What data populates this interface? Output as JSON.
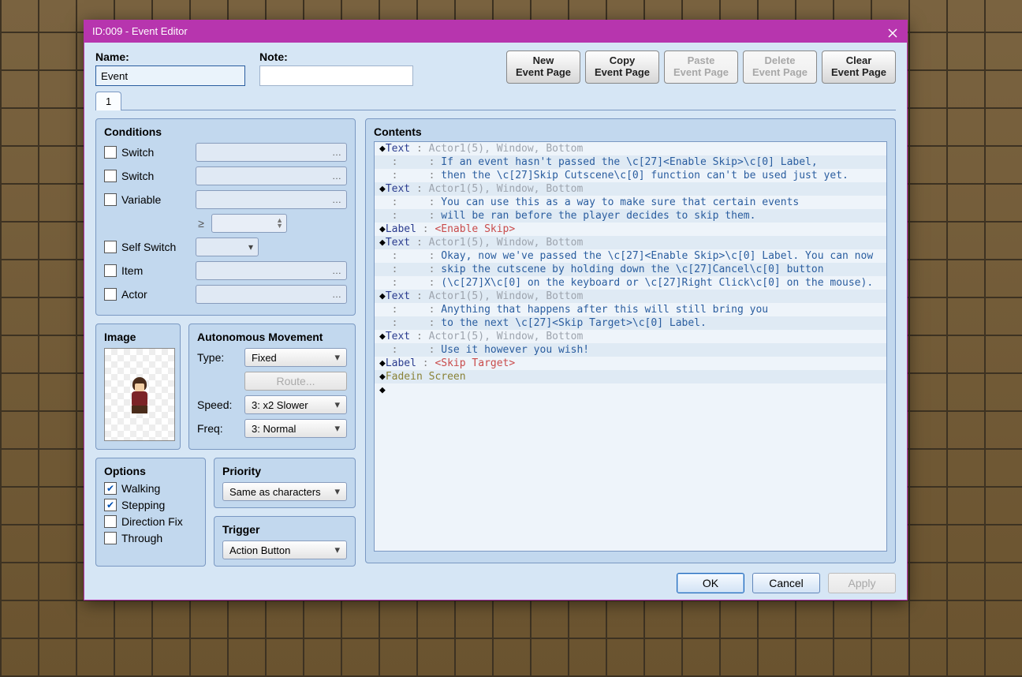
{
  "title": "ID:009 - Event Editor",
  "name_label": "Name:",
  "note_label": "Note:",
  "name_value": "Event",
  "note_value": "",
  "page_buttons": [
    {
      "l1": "New",
      "l2": "Event Page",
      "disabled": false
    },
    {
      "l1": "Copy",
      "l2": "Event Page",
      "disabled": false
    },
    {
      "l1": "Paste",
      "l2": "Event Page",
      "disabled": true
    },
    {
      "l1": "Delete",
      "l2": "Event Page",
      "disabled": true
    },
    {
      "l1": "Clear",
      "l2": "Event Page",
      "disabled": false
    }
  ],
  "tabs": [
    "1"
  ],
  "conditions": {
    "heading": "Conditions",
    "rows": [
      {
        "label": "Switch",
        "kind": "dd"
      },
      {
        "label": "Switch",
        "kind": "dd"
      },
      {
        "label": "Variable",
        "kind": "dd"
      },
      {
        "label": "",
        "kind": "ge_spin",
        "ge": "≥"
      },
      {
        "label": "Self Switch",
        "kind": "dd_s"
      },
      {
        "label": "Item",
        "kind": "dd"
      },
      {
        "label": "Actor",
        "kind": "dd"
      }
    ]
  },
  "image_heading": "Image",
  "auto": {
    "heading": "Autonomous Movement",
    "type_label": "Type:",
    "type_value": "Fixed",
    "route_label": "Route...",
    "speed_label": "Speed:",
    "speed_value": "3: x2 Slower",
    "freq_label": "Freq:",
    "freq_value": "3: Normal"
  },
  "options": {
    "heading": "Options",
    "items": [
      {
        "label": "Walking",
        "checked": true
      },
      {
        "label": "Stepping",
        "checked": true
      },
      {
        "label": "Direction Fix",
        "checked": false
      },
      {
        "label": "Through",
        "checked": false
      }
    ]
  },
  "priority": {
    "heading": "Priority",
    "value": "Same as characters"
  },
  "trigger": {
    "heading": "Trigger",
    "value": "Action Button"
  },
  "contents_heading": "Contents",
  "contents": [
    {
      "t": "text-head",
      "meta": "Actor1(5), Window, Bottom"
    },
    {
      "t": "text-line",
      "body": "If an event hasn't passed the \\c[27]<Enable Skip>\\c[0] Label,"
    },
    {
      "t": "text-line",
      "body": "then the \\c[27]Skip Cutscene\\c[0] function can't be used just yet."
    },
    {
      "t": "text-head",
      "meta": "Actor1(5), Window, Bottom"
    },
    {
      "t": "text-line",
      "body": "You can use this as a way to make sure that certain events"
    },
    {
      "t": "text-line",
      "body": "will be ran before the player decides to skip them."
    },
    {
      "t": "label",
      "body": "<Enable Skip>"
    },
    {
      "t": "text-head",
      "meta": "Actor1(5), Window, Bottom"
    },
    {
      "t": "text-line",
      "body": "Okay, now we've passed the \\c[27]<Enable Skip>\\c[0] Label. You can now"
    },
    {
      "t": "text-line",
      "body": "skip the cutscene by holding down the \\c[27]Cancel\\c[0] button"
    },
    {
      "t": "text-line",
      "body": "(\\c[27]X\\c[0] on the keyboard or \\c[27]Right Click\\c[0] on the mouse)."
    },
    {
      "t": "text-head",
      "meta": "Actor1(5), Window, Bottom"
    },
    {
      "t": "text-line",
      "body": "Anything that happens after this will still bring you"
    },
    {
      "t": "text-line",
      "body": "to the next \\c[27]<Skip Target>\\c[0] Label."
    },
    {
      "t": "text-head",
      "meta": "Actor1(5), Window, Bottom"
    },
    {
      "t": "text-line",
      "body": "Use it however you wish!"
    },
    {
      "t": "label",
      "body": "<Skip Target>"
    },
    {
      "t": "fadein"
    },
    {
      "t": "blank"
    }
  ],
  "footer": {
    "ok": "OK",
    "cancel": "Cancel",
    "apply": "Apply"
  }
}
